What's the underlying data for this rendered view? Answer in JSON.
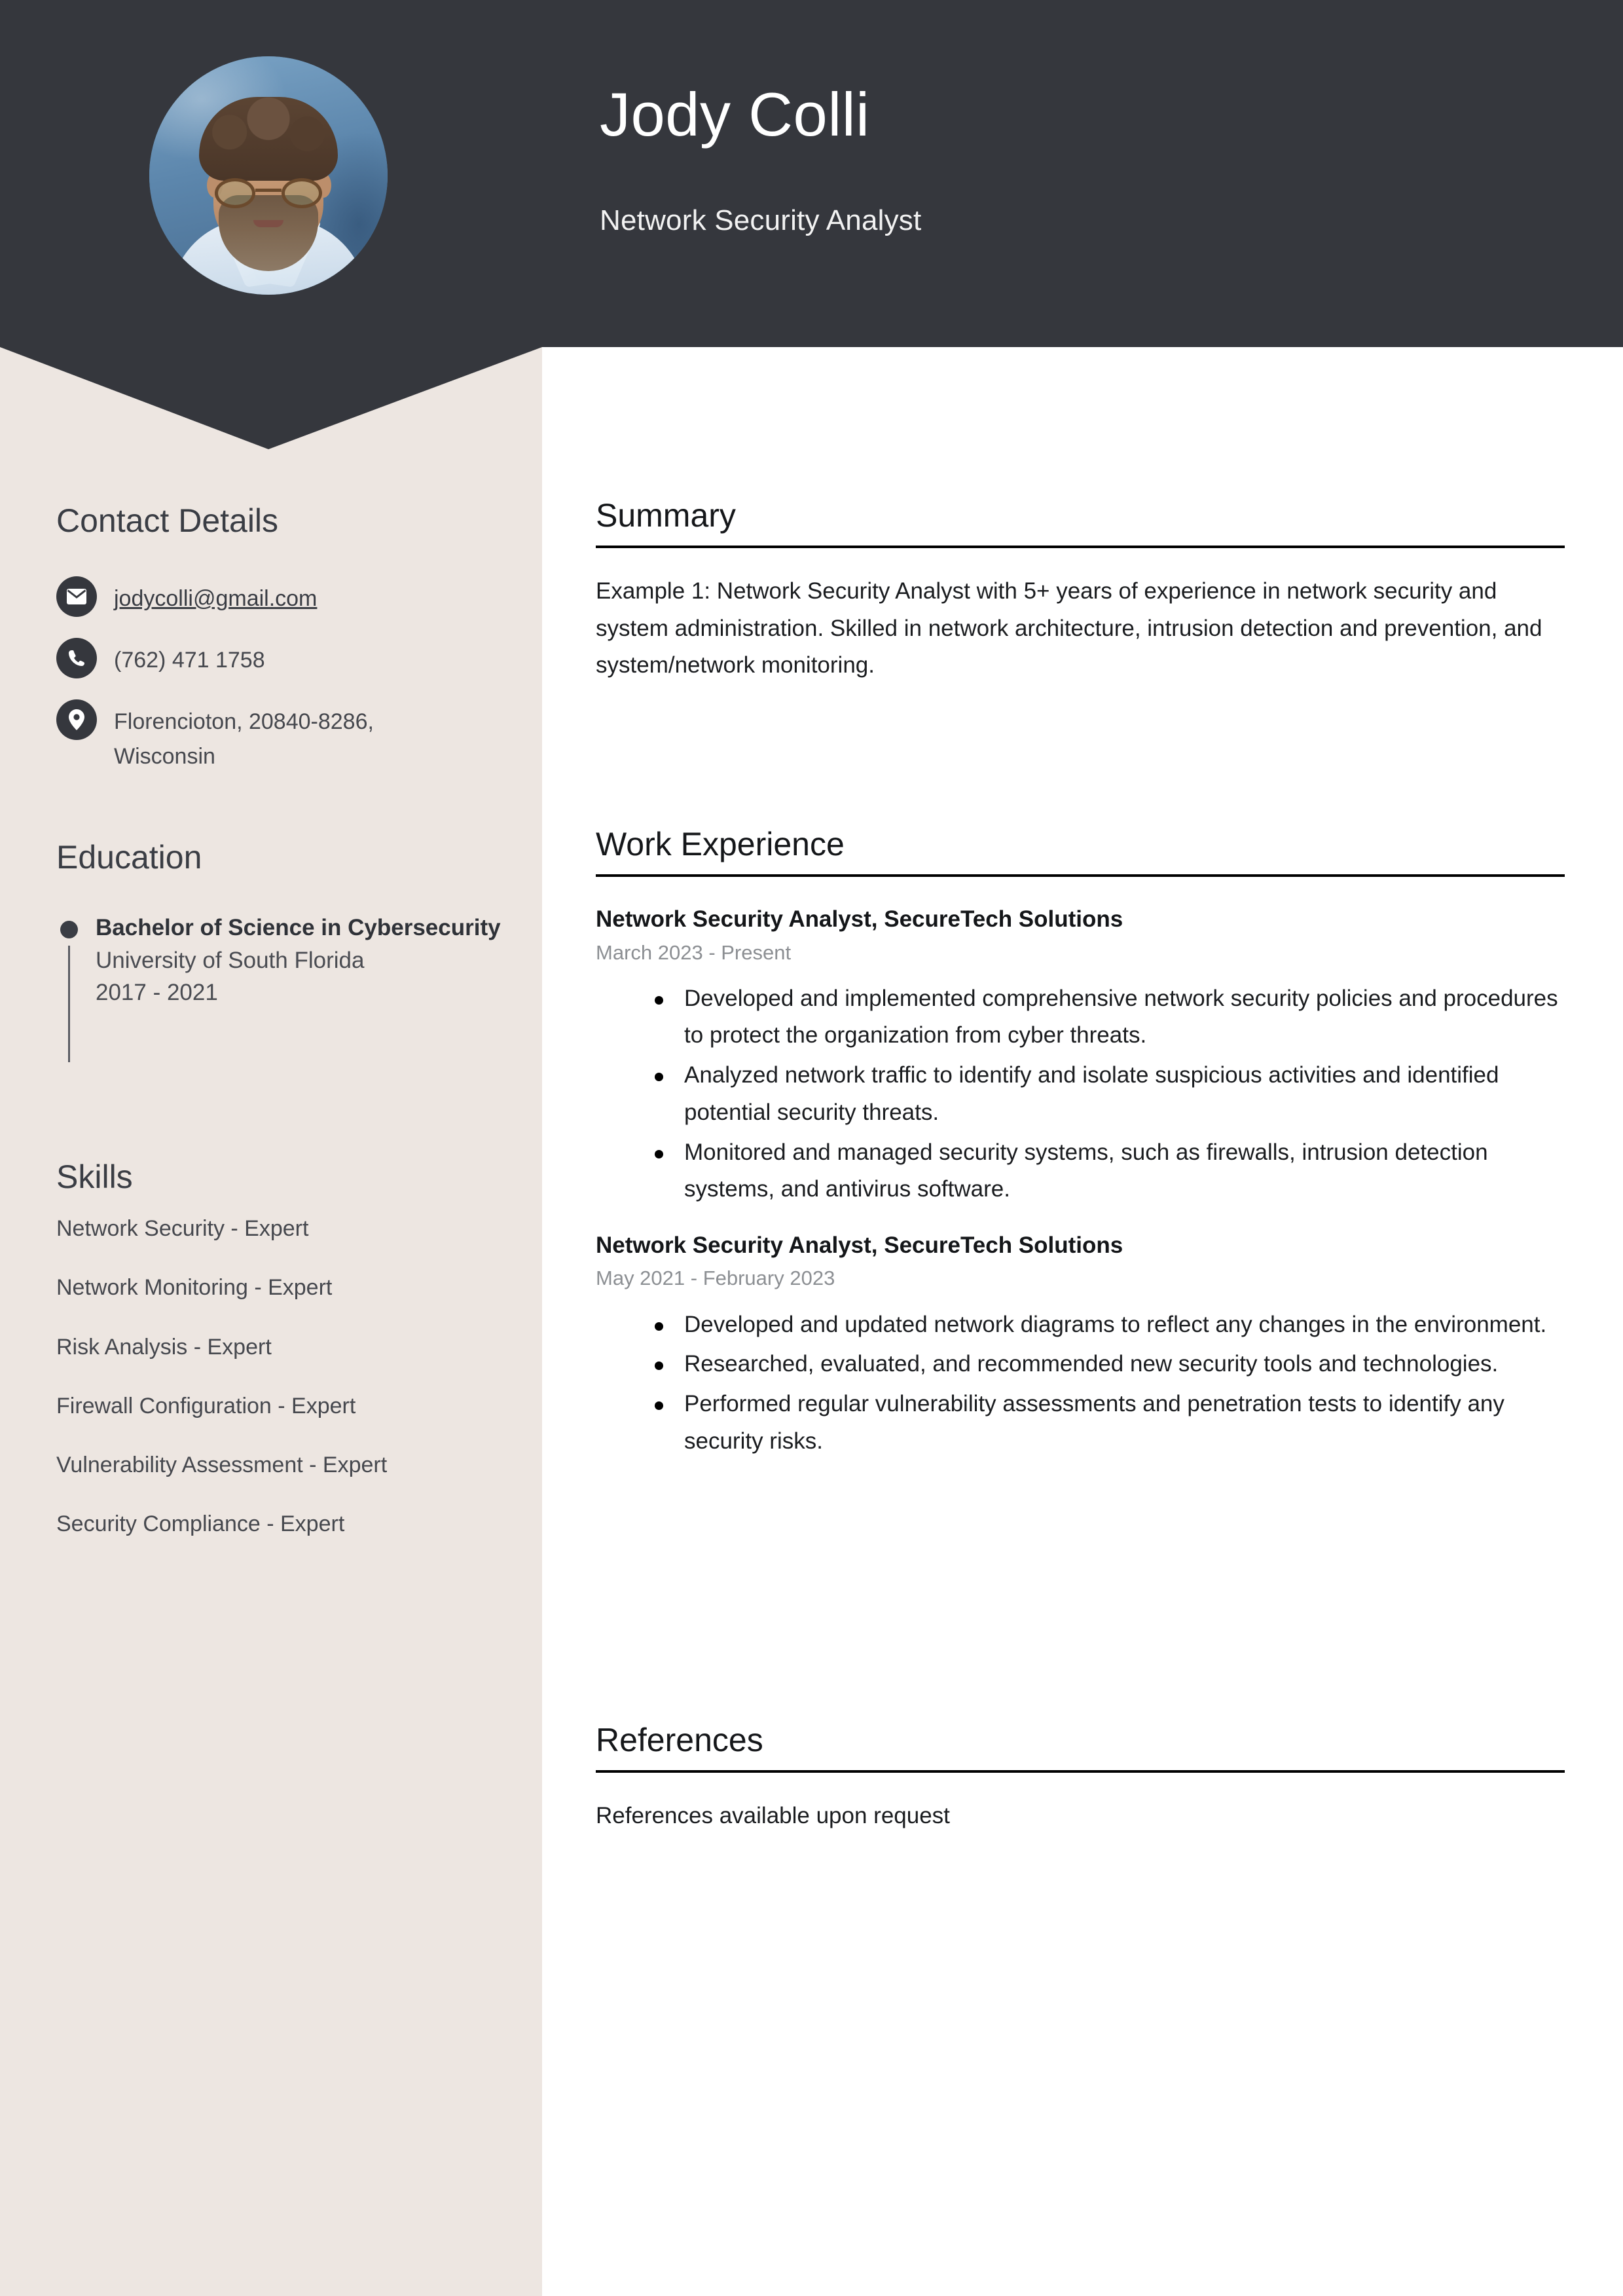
{
  "colors": {
    "header_bg": "#35373D",
    "sidebar_bg": "#EDE6E1",
    "main_bg": "#FFFFFF",
    "heading_dark": "#15171A",
    "muted_text": "#8C8F93"
  },
  "header": {
    "name": "Jody Colli",
    "job_title": "Network Security Analyst",
    "photo_alt": "profile-photo"
  },
  "sidebar": {
    "contact": {
      "heading": "Contact Details",
      "items": [
        {
          "icon": "envelope-icon",
          "value": "jodycolli@gmail.com",
          "is_link": true
        },
        {
          "icon": "phone-icon",
          "value": "(762) 471 1758",
          "is_link": false
        },
        {
          "icon": "location-pin-icon",
          "value": "Florencioton, 20840-8286, Wisconsin",
          "is_link": false
        }
      ]
    },
    "education": {
      "heading": "Education",
      "items": [
        {
          "degree": "Bachelor of Science in Cybersecurity",
          "school": "University of South Florida",
          "years": "2017 - 2021"
        }
      ]
    },
    "skills": {
      "heading": "Skills",
      "items": [
        "Network Security - Expert",
        "Network Monitoring - Expert",
        "Risk Analysis - Expert",
        "Firewall Configuration - Expert",
        "Vulnerability Assessment - Expert",
        "Security Compliance - Expert"
      ]
    }
  },
  "main": {
    "summary": {
      "heading": "Summary",
      "text": "Example 1: Network Security Analyst with 5+ years of experience in network security and system administration. Skilled in network architecture, intrusion detection and prevention, and system/network monitoring."
    },
    "work_experience": {
      "heading": "Work Experience",
      "jobs": [
        {
          "title": "Network Security Analyst, SecureTech Solutions",
          "dates": "March 2023 - Present",
          "duties": [
            "Developed and implemented comprehensive network security policies and procedures to protect the organization from cyber threats.",
            "Analyzed network traffic to identify and isolate suspicious activities and identified potential security threats.",
            "Monitored and managed security systems, such as firewalls, intrusion detection systems, and antivirus software."
          ]
        },
        {
          "title": "Network Security Analyst, SecureTech Solutions",
          "dates": "May 2021 - February 2023",
          "duties": [
            "Developed and updated network diagrams to reflect any changes in the environment.",
            "Researched, evaluated, and recommended new security tools and technologies.",
            "Performed regular vulnerability assessments and penetration tests to identify any security risks."
          ]
        }
      ]
    },
    "references": {
      "heading": "References",
      "text": "References available upon request"
    }
  }
}
